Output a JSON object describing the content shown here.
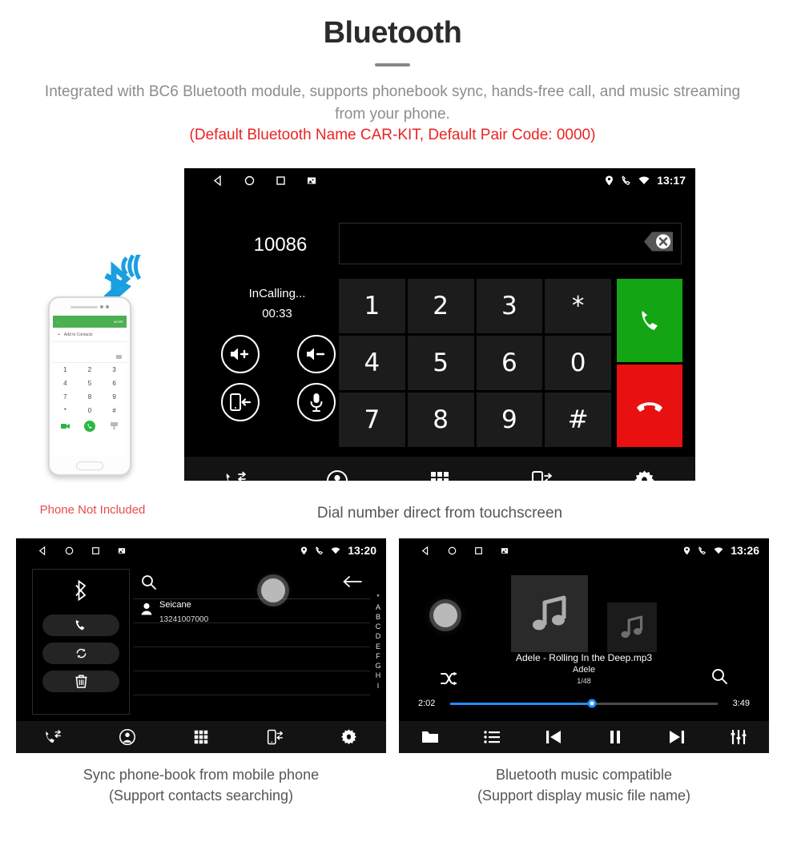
{
  "header": {
    "title": "Bluetooth",
    "subtitle": "Integrated with BC6 Bluetooth module, supports phonebook sync, hands-free call, and music streaming from your phone.",
    "note": "(Default Bluetooth Name CAR-KIT, Default Pair Code: 0000)",
    "note_color": "#ee2222"
  },
  "dialer": {
    "statusbar": {
      "time": "13:17"
    },
    "number": "10086",
    "input_value": "",
    "call_status": "InCalling...",
    "call_timer": "00:33",
    "call_buttons": [
      {
        "name": "volume-up-button",
        "icon": "speaker-plus-icon"
      },
      {
        "name": "volume-down-button",
        "icon": "speaker-minus-icon"
      },
      {
        "name": "transfer-to-phone-button",
        "icon": "phone-transfer-icon"
      },
      {
        "name": "mute-microphone-button",
        "icon": "microphone-icon"
      }
    ],
    "keys": [
      "1",
      "2",
      "3",
      "*",
      "4",
      "5",
      "6",
      "0",
      "7",
      "8",
      "9",
      "#"
    ],
    "answer_label": "call-icon",
    "answer_color": "#13a513",
    "hangup_label": "hangup-icon",
    "hangup_color": "#e81010",
    "navbar": [
      "call-log-icon",
      "contacts-icon",
      "keypad-icon",
      "phone-sync-icon",
      "settings-icon"
    ],
    "caption": "Dial number direct from touchscreen"
  },
  "phone_mock": {
    "appbar_back": "←",
    "appbar_more": "MORE",
    "add_contact": "Add to Contacts",
    "keys": [
      "1",
      "2",
      "3",
      "4",
      "5",
      "6",
      "7",
      "8",
      "9",
      "*",
      "0",
      "#"
    ],
    "not_included": "Phone Not Included",
    "not_included_color": "#e74b4b",
    "bt_logo_color": "#1a9fe0"
  },
  "phonebook": {
    "statusbar": {
      "time": "13:20"
    },
    "side_buttons": [
      {
        "name": "bluetooth-icon",
        "label": "bluetooth"
      },
      {
        "name": "phone-call-button",
        "label": "call"
      },
      {
        "name": "sync-contacts-button",
        "label": "sync"
      },
      {
        "name": "delete-contacts-button",
        "label": "delete"
      }
    ],
    "search_placeholder": "",
    "contacts": [
      {
        "name": "Seicane",
        "number": "13241007000"
      }
    ],
    "empty_rows": 4,
    "index_letters": [
      "*",
      "A",
      "B",
      "C",
      "D",
      "E",
      "F",
      "G",
      "H",
      "I"
    ],
    "navbar": [
      "call-log-icon",
      "contacts-icon",
      "keypad-icon",
      "phone-sync-icon",
      "settings-icon"
    ],
    "caption_line1": "Sync phone-book from mobile phone",
    "caption_line2": "(Support contacts searching)"
  },
  "music": {
    "statusbar": {
      "time": "13:26"
    },
    "track_title": "Adele - Rolling In the Deep.mp3",
    "artist": "Adele",
    "track_count": "1/48",
    "elapsed": "2:02",
    "duration": "3:49",
    "progress_percent": 53,
    "accent_color": "#1e90ff",
    "controls": [
      "folder-icon",
      "playlist-icon",
      "previous-icon",
      "pause-icon",
      "next-icon",
      "equalizer-icon"
    ],
    "caption_line1": "Bluetooth music compatible",
    "caption_line2": "(Support display music file name)"
  }
}
